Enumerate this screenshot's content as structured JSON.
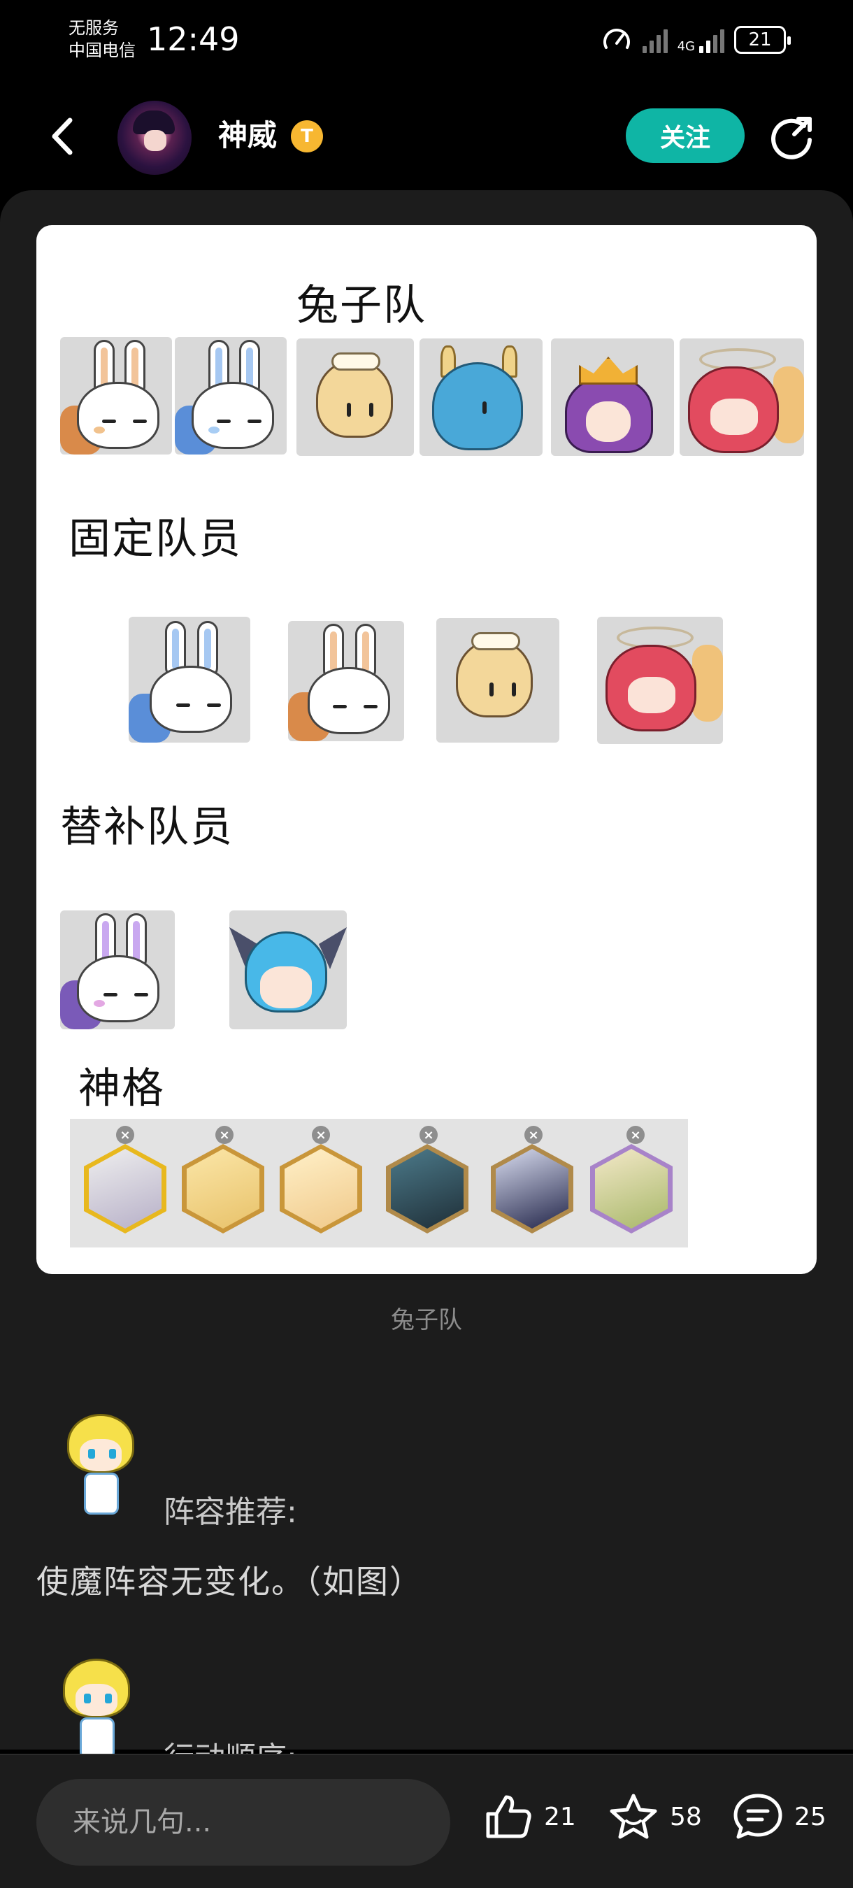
{
  "status_bar": {
    "carrier_line1": "无服务",
    "carrier_line2": "中国电信",
    "time": "12:49",
    "network": "4G",
    "battery": "21"
  },
  "header": {
    "username": "神威",
    "badge": "T",
    "follow_label": "关注"
  },
  "post_image": {
    "title": "兔子队",
    "fixed_members_label": "固定队员",
    "substitutes_label": "替补队员",
    "divinity_label": "神格",
    "top_row_icons": [
      "rabbit-orange-icon",
      "rabbit-blue-icon",
      "blonde-girl-icon",
      "blue-dragon-icon",
      "purple-queen-icon",
      "red-angel-icon"
    ],
    "fixed_icons": [
      "rabbit-blue-icon",
      "rabbit-orange-icon",
      "blonde-girl-icon",
      "red-angel-icon"
    ],
    "substitute_icons": [
      "rabbit-purple-icon",
      "blue-bat-girl-icon"
    ],
    "divinity_icons": [
      "silver-knight-icon",
      "blonde-horned-icon",
      "golden-priest-icon",
      "dark-beast-icon",
      "navy-witch-icon",
      "green-flower-icon"
    ]
  },
  "caption": "兔子队",
  "sections": {
    "lineup_title": "阵容推荐:",
    "lineup_text": "使魔阵容无变化。（如图）",
    "order_title": "行动顺序:"
  },
  "bottom_bar": {
    "comment_placeholder": "来说几句...",
    "likes": "21",
    "favorites": "58",
    "comments": "25"
  },
  "colors": {
    "accent": "#0fb5a5",
    "background": "#000000",
    "panel": "#1c1c1c",
    "badge": "#f7b731"
  }
}
